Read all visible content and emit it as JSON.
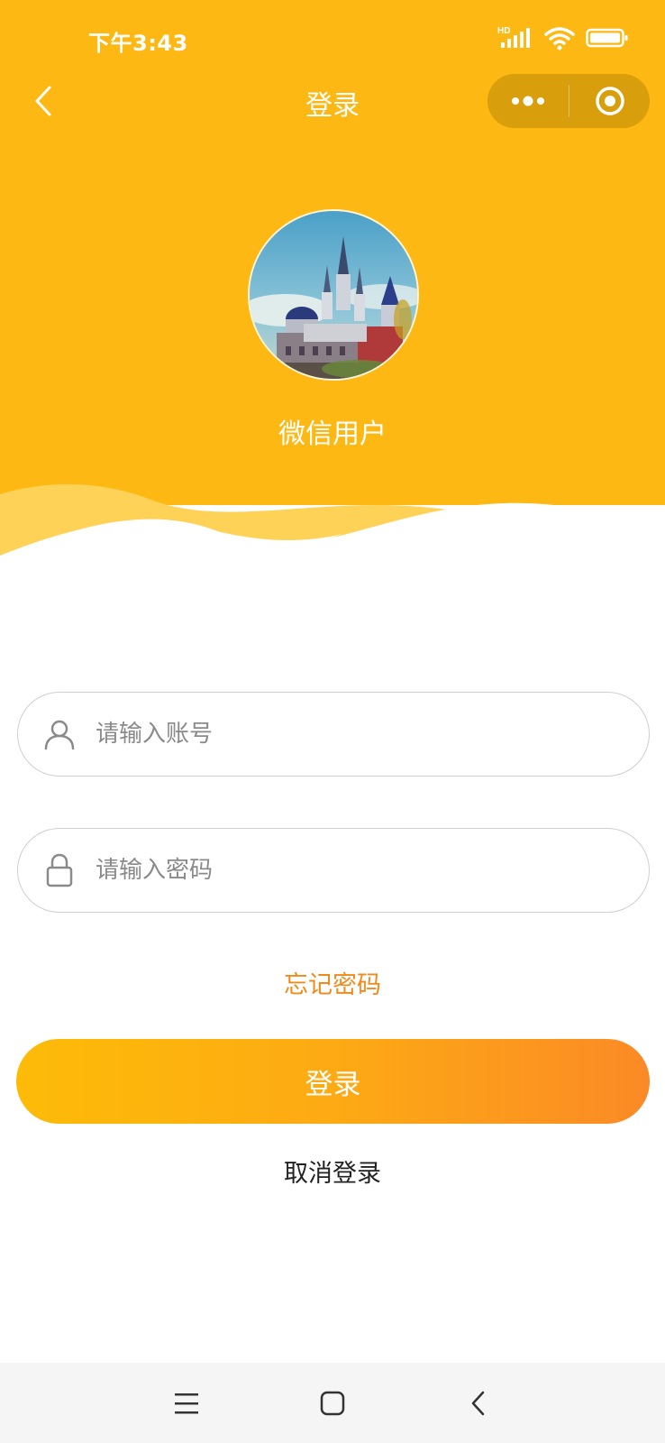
{
  "status_bar": {
    "time": "下午3:43",
    "network_label": "HD",
    "icons": [
      "signal-icon",
      "wifi-icon",
      "battery-icon"
    ]
  },
  "nav": {
    "title": "登录",
    "icons": [
      "back-arrow-icon",
      "more-dots-icon",
      "close-target-icon"
    ]
  },
  "profile": {
    "username": "微信用户",
    "avatar_description_icon": "castle-avatar"
  },
  "form": {
    "account_placeholder": "请输入账号",
    "password_placeholder": "请输入密码",
    "account_value": "",
    "password_value": "",
    "forgot_label": "忘记密码",
    "login_label": "登录",
    "cancel_label": "取消登录"
  },
  "system_nav": {
    "icons": [
      "menu-icon",
      "home-icon",
      "back-icon"
    ]
  },
  "colors": {
    "header": "#fdb813",
    "wave_light": "#fdd257",
    "accent_text": "#f28a1a",
    "button_start": "#fdbb08",
    "button_end": "#fb8a26"
  }
}
